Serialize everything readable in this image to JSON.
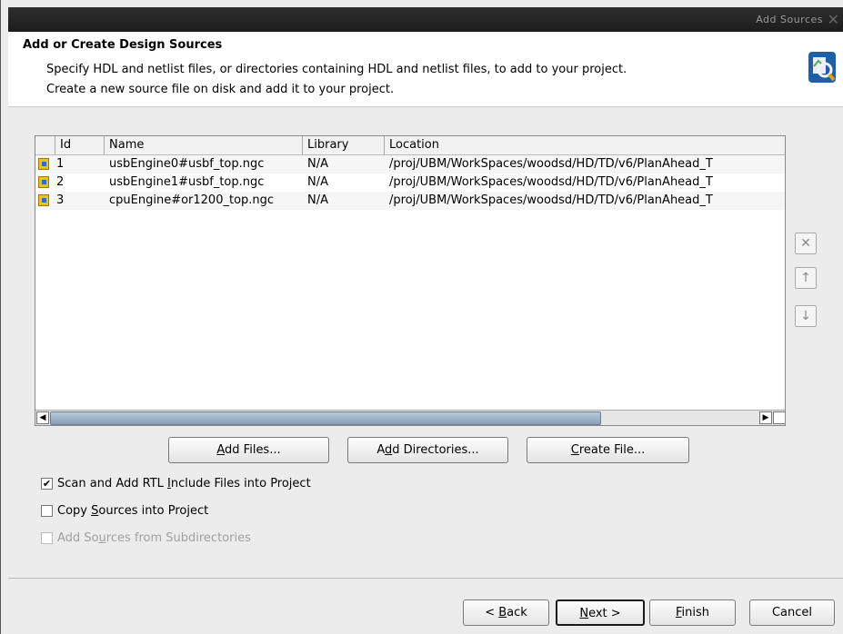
{
  "window": {
    "title": "Add Sources"
  },
  "header": {
    "title": "Add or Create Design Sources",
    "desc1": "Specify HDL and netlist files, or directories containing HDL and netlist files, to add to your project.",
    "desc2": "Create a new source file on disk and add it to your project."
  },
  "table": {
    "columns": {
      "id": "Id",
      "name": "Name",
      "library": "Library",
      "location": "Location"
    },
    "rows": [
      {
        "id": "1",
        "name": "usbEngine0#usbf_top.ngc",
        "library": "N/A",
        "location": "/proj/UBM/WorkSpaces/woodsd/HD/TD/v6/PlanAhead_T"
      },
      {
        "id": "2",
        "name": "usbEngine1#usbf_top.ngc",
        "library": "N/A",
        "location": "/proj/UBM/WorkSpaces/woodsd/HD/TD/v6/PlanAhead_T"
      },
      {
        "id": "3",
        "name": "cpuEngine#or1200_top.ngc",
        "library": "N/A",
        "location": "/proj/UBM/WorkSpaces/woodsd/HD/TD/v6/PlanAhead_T"
      }
    ]
  },
  "side": {
    "remove": "✕",
    "up": "↑",
    "down": "↓"
  },
  "actions": {
    "add_files_pre": "",
    "add_files_u": "A",
    "add_files_post": "dd Files...",
    "add_dirs_pre": "A",
    "add_dirs_u": "d",
    "add_dirs_post": "d Directories...",
    "create_pre": "",
    "create_u": "C",
    "create_post": "reate File..."
  },
  "options": {
    "scan_pre": "Scan and Add RTL ",
    "scan_u": "I",
    "scan_post": "nclude Files into Project",
    "scan_checked": true,
    "copy_pre": "Copy ",
    "copy_u": "S",
    "copy_post": "ources into Project",
    "copy_checked": false,
    "sub_pre": "Add So",
    "sub_u": "u",
    "sub_post": "rces from Subdirectories",
    "sub_checked": false
  },
  "footer": {
    "back_pre": "< ",
    "back_u": "B",
    "back_post": "ack",
    "next_u": "N",
    "next_post": "ext >",
    "finish_u": "F",
    "finish_post": "inish",
    "cancel": "Cancel"
  }
}
